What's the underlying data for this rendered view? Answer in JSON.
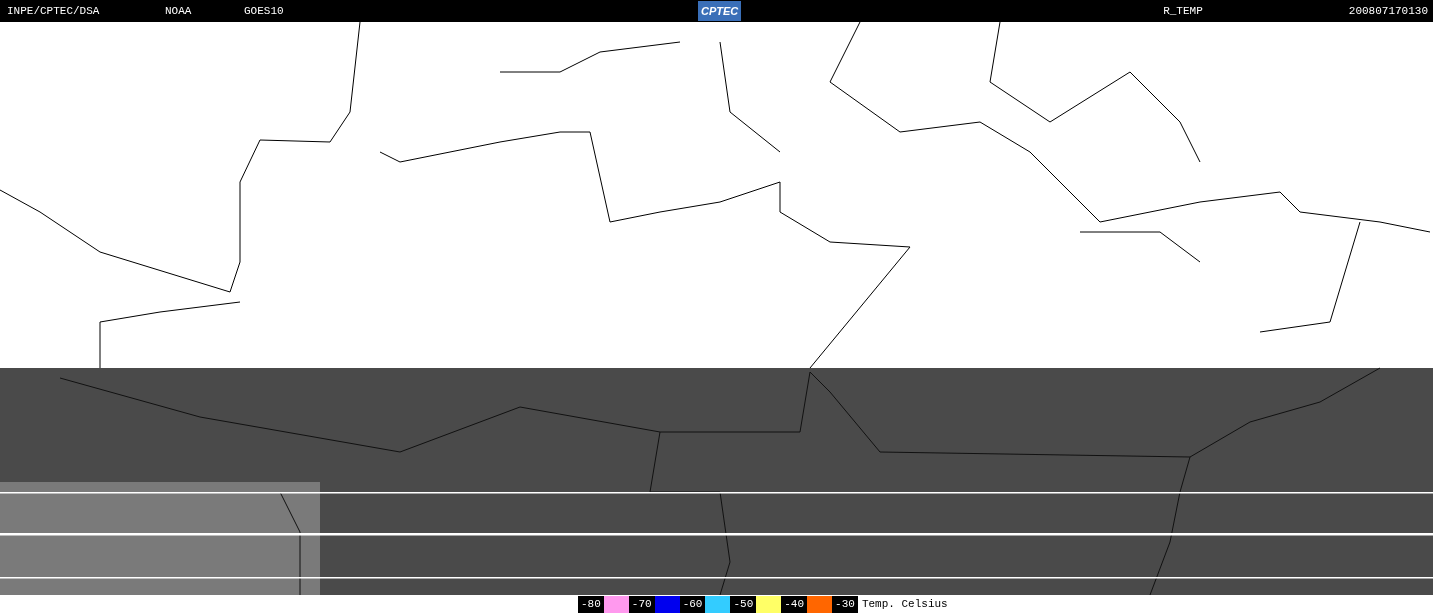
{
  "header": {
    "left": [
      "INPE/CPTEC/DSA",
      "NOAA",
      "GOES10"
    ],
    "logo": "CPTEC",
    "product": "R_TEMP",
    "timestamp": "200807170130"
  },
  "legend": {
    "stops": [
      {
        "label": "-80",
        "color": "#ff99ee"
      },
      {
        "label": "-70",
        "color": "#0000ee"
      },
      {
        "label": "-60",
        "color": "#33ccff"
      },
      {
        "label": "-50",
        "color": "#ffff66"
      },
      {
        "label": "-40",
        "color": "#ff6600"
      },
      {
        "label": "-30"
      }
    ],
    "unit": "Temp. Celsius"
  }
}
